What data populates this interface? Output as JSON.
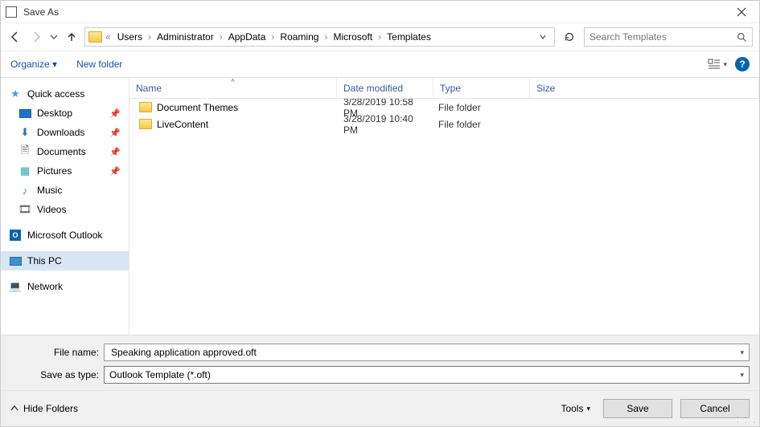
{
  "title": "Save As",
  "breadcrumbs": [
    "Users",
    "Administrator",
    "AppData",
    "Roaming",
    "Microsoft",
    "Templates"
  ],
  "search_placeholder": "Search Templates",
  "toolbar": {
    "organize": "Organize",
    "newfolder": "New folder"
  },
  "nav": {
    "quick_access": "Quick access",
    "desktop": "Desktop",
    "downloads": "Downloads",
    "documents": "Documents",
    "pictures": "Pictures",
    "music": "Music",
    "videos": "Videos",
    "outlook": "Microsoft Outlook",
    "thispc": "This PC",
    "network": "Network"
  },
  "columns": {
    "name": "Name",
    "date": "Date modified",
    "type": "Type",
    "size": "Size"
  },
  "files": [
    {
      "name": "Document Themes",
      "date": "3/28/2019 10:58 PM",
      "type": "File folder"
    },
    {
      "name": "LiveContent",
      "date": "3/28/2019 10:40 PM",
      "type": "File folder"
    }
  ],
  "form": {
    "filename_label": "File name:",
    "filename_value": "Speaking application approved.oft",
    "type_label": "Save as type:",
    "type_value": "Outlook Template (*.oft)"
  },
  "footer": {
    "hide": "Hide Folders",
    "tools": "Tools",
    "save": "Save",
    "cancel": "Cancel"
  }
}
